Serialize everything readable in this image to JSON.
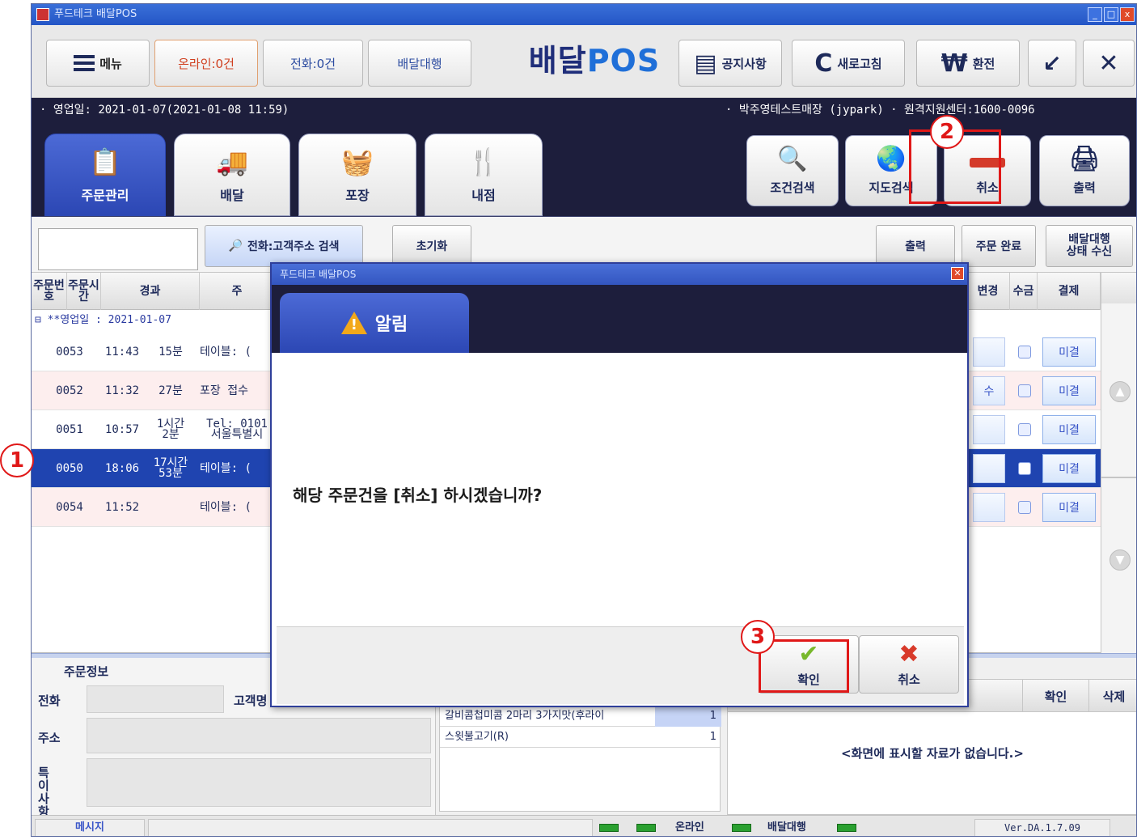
{
  "window": {
    "title": "푸드테크 배달POS",
    "controls": [
      "_",
      "□",
      "x"
    ]
  },
  "topbar": {
    "menu_label": "메뉴",
    "online_label": "온라인:0건",
    "phone_label": "전화:0건",
    "agency_label": "배달대행",
    "brand_main": "배달",
    "brand_pos": "POS",
    "notice_label": "공지사항",
    "refresh_label": "새로고침",
    "exchange_label": "환전",
    "refresh_icon": "C",
    "exchange_icon": "₩",
    "minimize_icon": "↙",
    "close_icon": "✕"
  },
  "info": {
    "business_date": "· 영업일: 2021-01-07(2021-01-08 11:59)",
    "store": "· 박주영테스트매장 (jypark)   · 원격지원센터:1600-0096"
  },
  "tabs": [
    {
      "label": "주문관리",
      "icon": "clipboard-icon"
    },
    {
      "label": "배달",
      "icon": "truck-icon"
    },
    {
      "label": "포장",
      "icon": "basket-icon"
    },
    {
      "label": "내점",
      "icon": "cutlery-icon"
    }
  ],
  "right_buttons": [
    {
      "label": "조건검색",
      "icon": "magnifier-icon"
    },
    {
      "label": "지도검색",
      "icon": "globe-icon"
    },
    {
      "label": "취소",
      "icon": "cancel-bar-icon"
    },
    {
      "label": "출력",
      "icon": "printer-icon"
    }
  ],
  "search": {
    "search_button": "전화:고객주소 검색",
    "reset_button": "초기화",
    "print_button": "출력",
    "complete_button": "주문 완료",
    "agency_status_button_line1": "배달대행",
    "agency_status_button_line2": "상태 수신"
  },
  "grid": {
    "headers": {
      "order_no": "주문번호",
      "order_time": "주문시간",
      "elapsed": "경과",
      "content_initial": "주",
      "change": "변경",
      "collect": "수금",
      "payment": "결제"
    },
    "group_label": "⊟ **영업일 : 2021-01-07",
    "rows": [
      {
        "no": "0053",
        "time": "11:43",
        "elapsed": "15분",
        "desc": "테이블: (",
        "change": "",
        "pay": "미결"
      },
      {
        "no": "0052",
        "time": "11:32",
        "elapsed": "27분",
        "desc": "포장 접수",
        "change": "수",
        "pay": "미결"
      },
      {
        "no": "0051",
        "time": "10:57",
        "elapsed": "1시간 2분",
        "desc": "Tel: 0101 서울특별시",
        "change": "",
        "pay": "미결"
      },
      {
        "no": "0050",
        "time": "18:06",
        "elapsed": "17시간 53분",
        "desc": "테이블: (",
        "change": "",
        "pay": "미결"
      },
      {
        "no": "0054",
        "time": "11:52",
        "elapsed": "",
        "desc": "테이블: (",
        "change": "",
        "pay": "미결"
      }
    ]
  },
  "order_info": {
    "title": "주문정보",
    "phone_label": "전화",
    "customer_label": "고객명",
    "address_label": "주소",
    "note_label": "특이사항"
  },
  "menu_items": [
    {
      "name": "갈비콤첩미콤 2마리 3가지맛(후라이",
      "qty": "1"
    },
    {
      "name": "스윗불고기(R)",
      "qty": "1"
    }
  ],
  "right_panel": {
    "confirm_header": "확인",
    "delete_header": "삭제",
    "empty_text": "<화면에 표시할 자료가 없습니다.>"
  },
  "statusbar": {
    "message_label": "메시지",
    "online_label": "온라인",
    "agency_label": "배달대행",
    "version": "Ver.DA.1.7.09"
  },
  "dialog": {
    "window_title": "푸드테크 배달POS",
    "header": "알림",
    "message": "해당 주문건을 [취소] 하시겠습니까?",
    "ok_label": "확인",
    "cancel_label": "취소"
  },
  "callouts": [
    "1",
    "2",
    "3"
  ],
  "colors": {
    "navy": "#1d1e3c",
    "accent_blue": "#2c47b4",
    "highlight_red": "#e01818",
    "selected_row": "#1f44b0"
  }
}
